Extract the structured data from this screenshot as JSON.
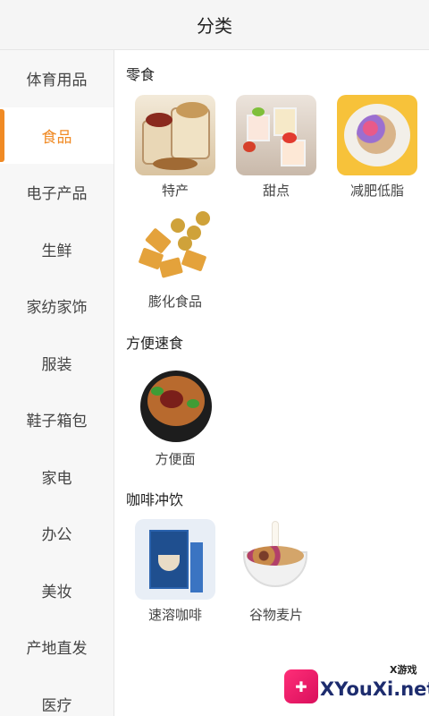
{
  "header": {
    "title": "分类"
  },
  "sidebar": {
    "items": [
      {
        "label": "体育用品",
        "active": false
      },
      {
        "label": "食品",
        "active": true
      },
      {
        "label": "电子产品",
        "active": false
      },
      {
        "label": "生鲜",
        "active": false
      },
      {
        "label": "家纺家饰",
        "active": false
      },
      {
        "label": "服装",
        "active": false
      },
      {
        "label": "鞋子箱包",
        "active": false
      },
      {
        "label": "家电",
        "active": false
      },
      {
        "label": "办公",
        "active": false
      },
      {
        "label": "美妆",
        "active": false
      },
      {
        "label": "产地直发",
        "active": false
      },
      {
        "label": "医疗",
        "active": false
      }
    ]
  },
  "accent_color": "#f08a24",
  "sections": [
    {
      "title": "零食",
      "items": [
        {
          "label": "特产",
          "icon": "specialty-food-image"
        },
        {
          "label": "甜点",
          "icon": "dessert-image"
        },
        {
          "label": "减肥低脂",
          "icon": "low-fat-image"
        },
        {
          "label": "膨化食品",
          "icon": "puffed-snack-image"
        }
      ]
    },
    {
      "title": "方便速食",
      "items": [
        {
          "label": "方便面",
          "icon": "instant-noodle-image"
        }
      ]
    },
    {
      "title": "咖啡冲饮",
      "items": [
        {
          "label": "速溶咖啡",
          "icon": "instant-coffee-image"
        },
        {
          "label": "谷物麦片",
          "icon": "cereal-image"
        }
      ]
    }
  ],
  "watermark": {
    "text": "XYouXi.net",
    "tag": "X游戏"
  }
}
